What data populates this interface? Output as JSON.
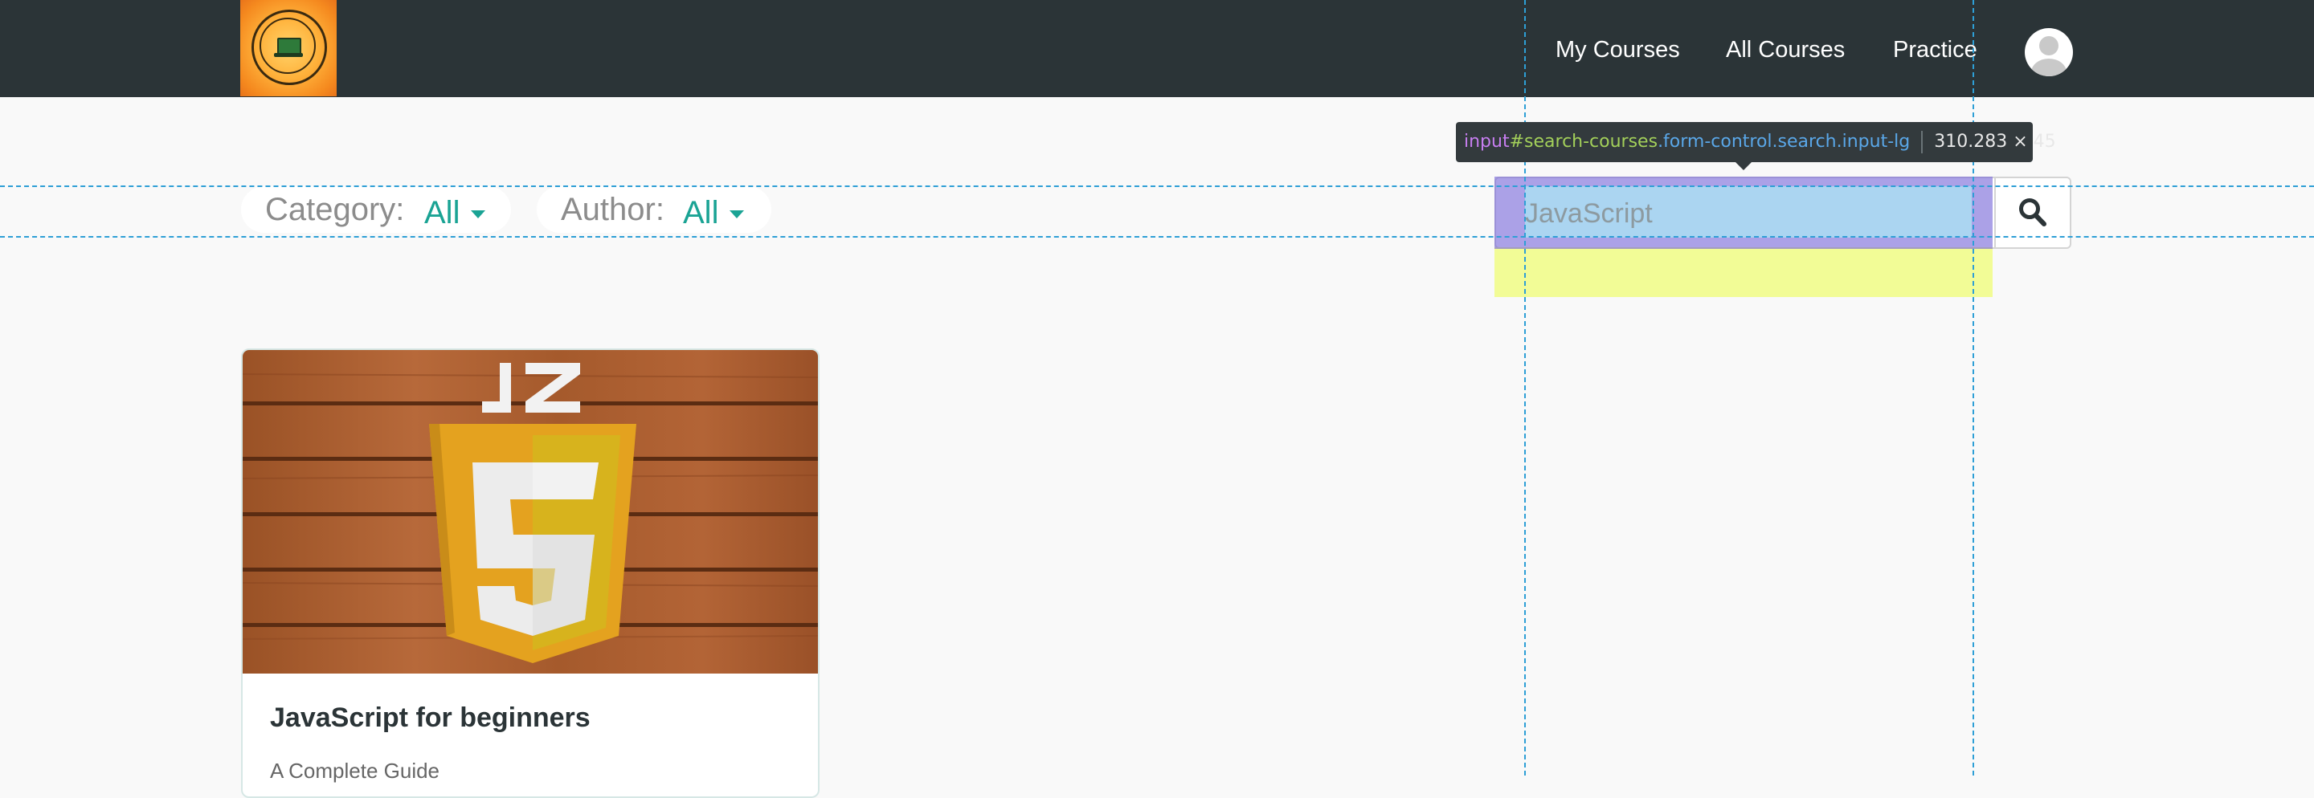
{
  "nav": {
    "links": [
      "My Courses",
      "All Courses",
      "Practice"
    ]
  },
  "filters": {
    "category": {
      "label": "Category:",
      "value": "All"
    },
    "author": {
      "label": "Author:",
      "value": "All"
    }
  },
  "search": {
    "placeholder": "JavaScript"
  },
  "devtools_tooltip": {
    "tag": "input",
    "id": "#search-courses",
    "classes": ".form-control.search.input-lg",
    "dimensions": "310.283 × 45"
  },
  "course": {
    "title": "JavaScript for beginners",
    "subtitle": "A Complete Guide",
    "image_logo_text": "JS"
  },
  "colors": {
    "navbar": "#2b3437",
    "accent": "#1aa394",
    "page_bg": "#f9f9f9"
  }
}
